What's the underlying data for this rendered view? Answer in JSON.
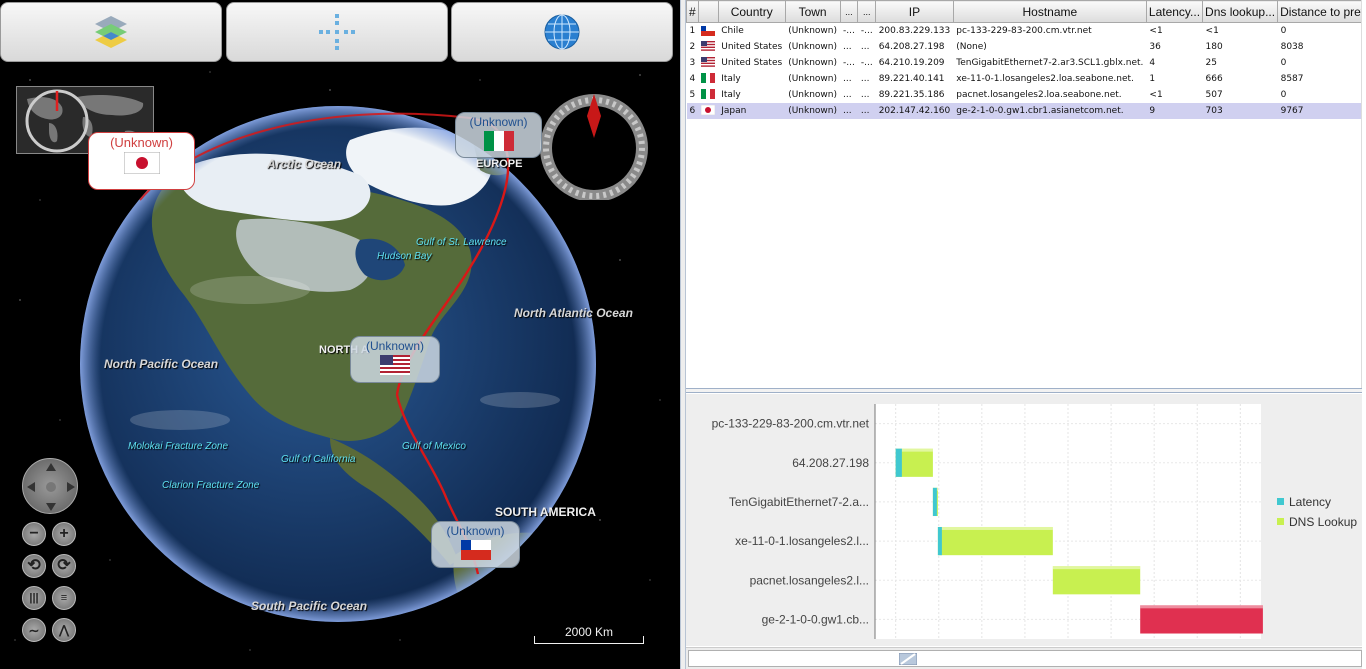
{
  "toolbar": {
    "buttons": [
      {
        "name": "layers-icon"
      },
      {
        "name": "crosshair-icon"
      },
      {
        "name": "globe-icon"
      }
    ]
  },
  "globe": {
    "geo_labels": {
      "arctic_ocean": "Arctic Ocean",
      "europe": "EUROPE",
      "gulf_st_lawrence": "Gulf of St. Lawrence",
      "hudson_bay": "Hudson Bay",
      "north_atlantic": "North Atlantic Ocean",
      "north_america": "NORTH A",
      "north_pacific": "North Pacific Ocean",
      "molokai": "Molokai Fracture Zone",
      "gulf_california": "Gulf of California",
      "gulf_mexico": "Gulf of Mexico",
      "clarion": "Clarion Fracture Zone",
      "south_america": "SOUTH AMERICA",
      "south_pacific": "South Pacific Ocean"
    },
    "markers": [
      {
        "country": "Japan",
        "label": "(Unknown)"
      },
      {
        "country": "Italy",
        "label": "(Unknown)"
      },
      {
        "country": "United States",
        "label": "(Unknown)"
      },
      {
        "country": "Chile",
        "label": "(Unknown)"
      }
    ],
    "scalebar": "2000 Km",
    "colors": {
      "route": "#d81818",
      "ocean": "#1b3c6e"
    }
  },
  "table": {
    "columns": [
      "#",
      "",
      "Country",
      "Town",
      "...",
      "...",
      "IP",
      "Hostname",
      "Latency...",
      "Dns lookup...",
      "Distance to previo..."
    ],
    "rows": [
      {
        "num": "1",
        "flag": "Chile",
        "country": "Chile",
        "town": "(Unknown)",
        "c4": "-...",
        "c5": "-...",
        "ip": "200.83.229.133",
        "host": "pc-133-229-83-200.cm.vtr.net",
        "latency": "<1",
        "dns": "<1",
        "dist": "0"
      },
      {
        "num": "2",
        "flag": "United States",
        "country": "United States",
        "town": "(Unknown)",
        "c4": "...",
        "c5": "...",
        "ip": "64.208.27.198",
        "host": "(None)",
        "latency": "36",
        "dns": "180",
        "dist": "8038"
      },
      {
        "num": "3",
        "flag": "United States",
        "country": "United States",
        "town": "(Unknown)",
        "c4": "-...",
        "c5": "-...",
        "ip": "64.210.19.209",
        "host": "TenGigabitEthernet7-2.ar3.SCL1.gblx.net.",
        "latency": "4",
        "dns": "25",
        "dist": "0"
      },
      {
        "num": "4",
        "flag": "Italy",
        "country": "Italy",
        "town": "(Unknown)",
        "c4": "...",
        "c5": "...",
        "ip": "89.221.40.141",
        "host": "xe-11-0-1.losangeles2.loa.seabone.net.",
        "latency": "1",
        "dns": "666",
        "dist": "8587"
      },
      {
        "num": "5",
        "flag": "Italy",
        "country": "Italy",
        "town": "(Unknown)",
        "c4": "...",
        "c5": "...",
        "ip": "89.221.35.186",
        "host": "pacnet.losangeles2.loa.seabone.net.",
        "latency": "<1",
        "dns": "507",
        "dist": "0"
      },
      {
        "num": "6",
        "flag": "Japan",
        "country": "Japan",
        "town": "(Unknown)",
        "c4": "...",
        "c5": "...",
        "ip": "202.147.42.160",
        "host": "ge-2-1-0-0.gw1.cbr1.asianetcom.net.",
        "latency": "9",
        "dns": "703",
        "dist": "9767"
      }
    ]
  },
  "chart_data": {
    "type": "bar",
    "orientation": "horizontal-gantt",
    "categories": [
      "pc-133-229-83-200.cm.vtr.net",
      "64.208.27.198",
      "TenGigabitEthernet7-2.a...",
      "xe-11-0-1.losangeles2.l...",
      "pacnet.losangeles2.l...",
      "ge-2-1-0-0.gw1.cb..."
    ],
    "series": [
      {
        "name": "Latency",
        "color": "#40c8d0"
      },
      {
        "name": "DNS Lookup",
        "color": "#c8f050"
      }
    ],
    "bars": [
      {
        "start": 0,
        "latency": 0,
        "dns": 0
      },
      {
        "start": 0,
        "latency": 36,
        "dns": 180
      },
      {
        "start": 216,
        "latency": 4,
        "dns": 25
      },
      {
        "start": 245,
        "latency": 1,
        "dns": 666
      },
      {
        "start": 912,
        "latency": 0,
        "dns": 507
      },
      {
        "start": 1419,
        "latency": 9,
        "dns": 703,
        "highlight": true
      }
    ],
    "xlim": [
      -120,
      2120
    ],
    "highlight_color": "#e03050",
    "legend": "right"
  }
}
